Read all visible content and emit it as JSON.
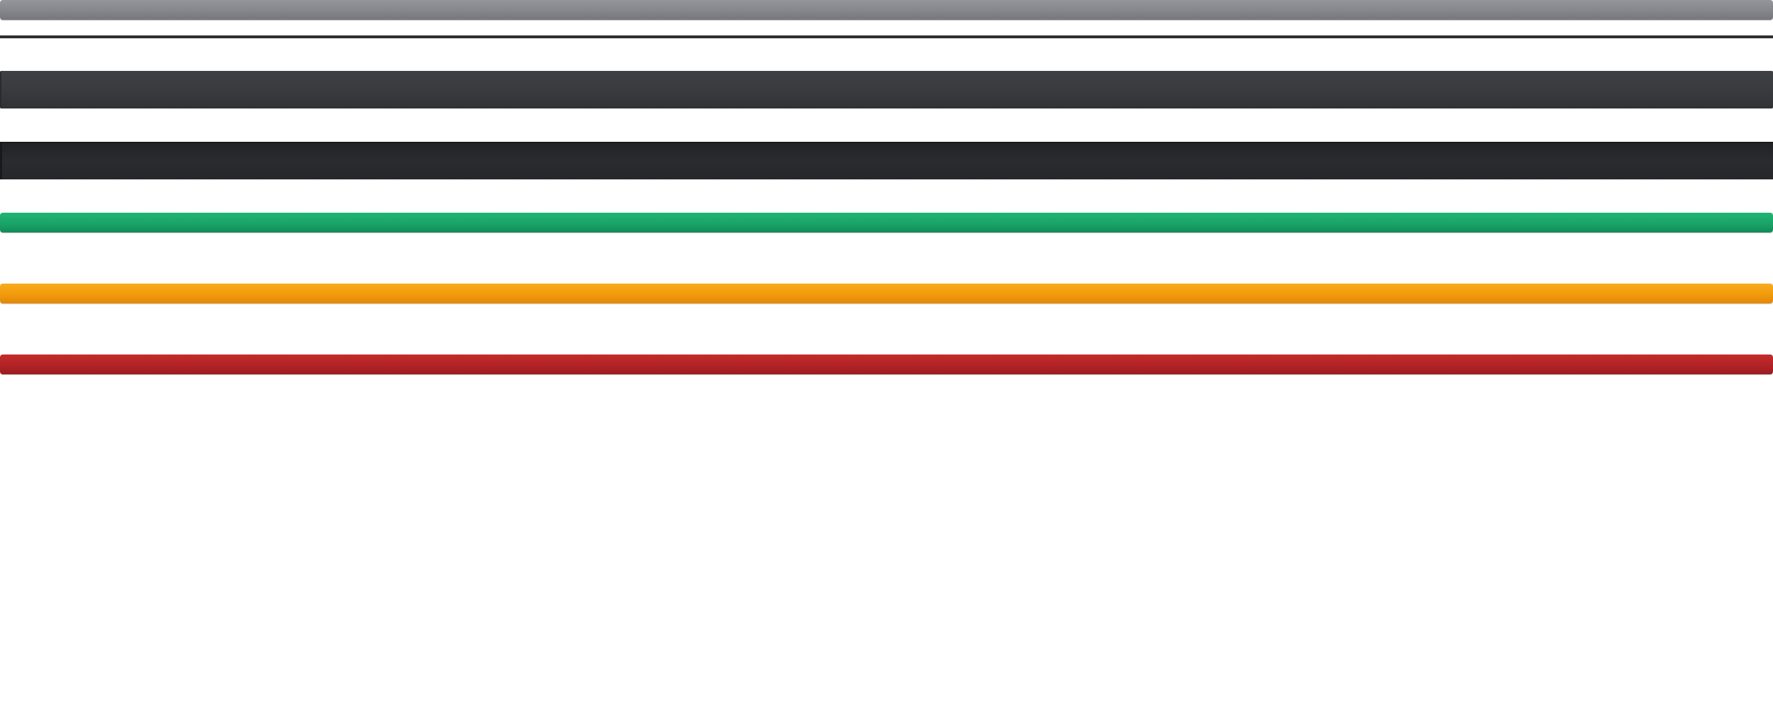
{
  "bars": [
    {
      "style": "gray-track",
      "color": "#85868b"
    },
    {
      "style": "thin-divider",
      "color": "#2b2c30"
    },
    {
      "style": "dark-panel",
      "color": "#3a3b3f"
    },
    {
      "style": "darker-panel",
      "color": "#2a2b2f"
    },
    {
      "style": "success",
      "color": "#19a468"
    },
    {
      "style": "warning",
      "color": "#f29a0c"
    },
    {
      "style": "danger",
      "color": "#b12326"
    }
  ],
  "background": "#ffffff"
}
